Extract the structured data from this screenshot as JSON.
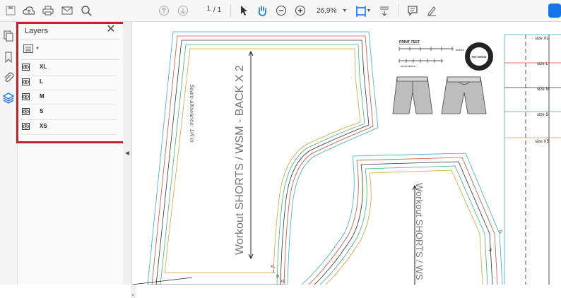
{
  "toolbar": {
    "current_page": "1",
    "page_separator": "/",
    "total_pages": "1",
    "zoom": "26,9%"
  },
  "layers_panel": {
    "title": "Layers",
    "close": "✕",
    "layers": [
      {
        "name": "XL"
      },
      {
        "name": "L"
      },
      {
        "name": "M"
      },
      {
        "name": "S"
      },
      {
        "name": "XS"
      }
    ]
  },
  "document": {
    "back_piece_title": "Workout SHORTS / WSM - BACK X 2",
    "back_piece_seam": "Seam allowance: 1/4 in",
    "front_piece_title": "Workout SHORTS / WS",
    "print_test_label": "PRINT TEST",
    "inches_label": "inches",
    "cm_label": "centimeters",
    "size_labels": [
      "size XL",
      "size L",
      "size M",
      "size S",
      "size XS"
    ],
    "size_codes": [
      "XL",
      "L",
      "M",
      "S",
      "XS"
    ],
    "badge_text": "PATTERNS",
    "colors": {
      "xl": "#3fa9c9",
      "l": "#c9503c",
      "m": "#333333",
      "s": "#3fb07a",
      "xs": "#d9a03a"
    }
  }
}
